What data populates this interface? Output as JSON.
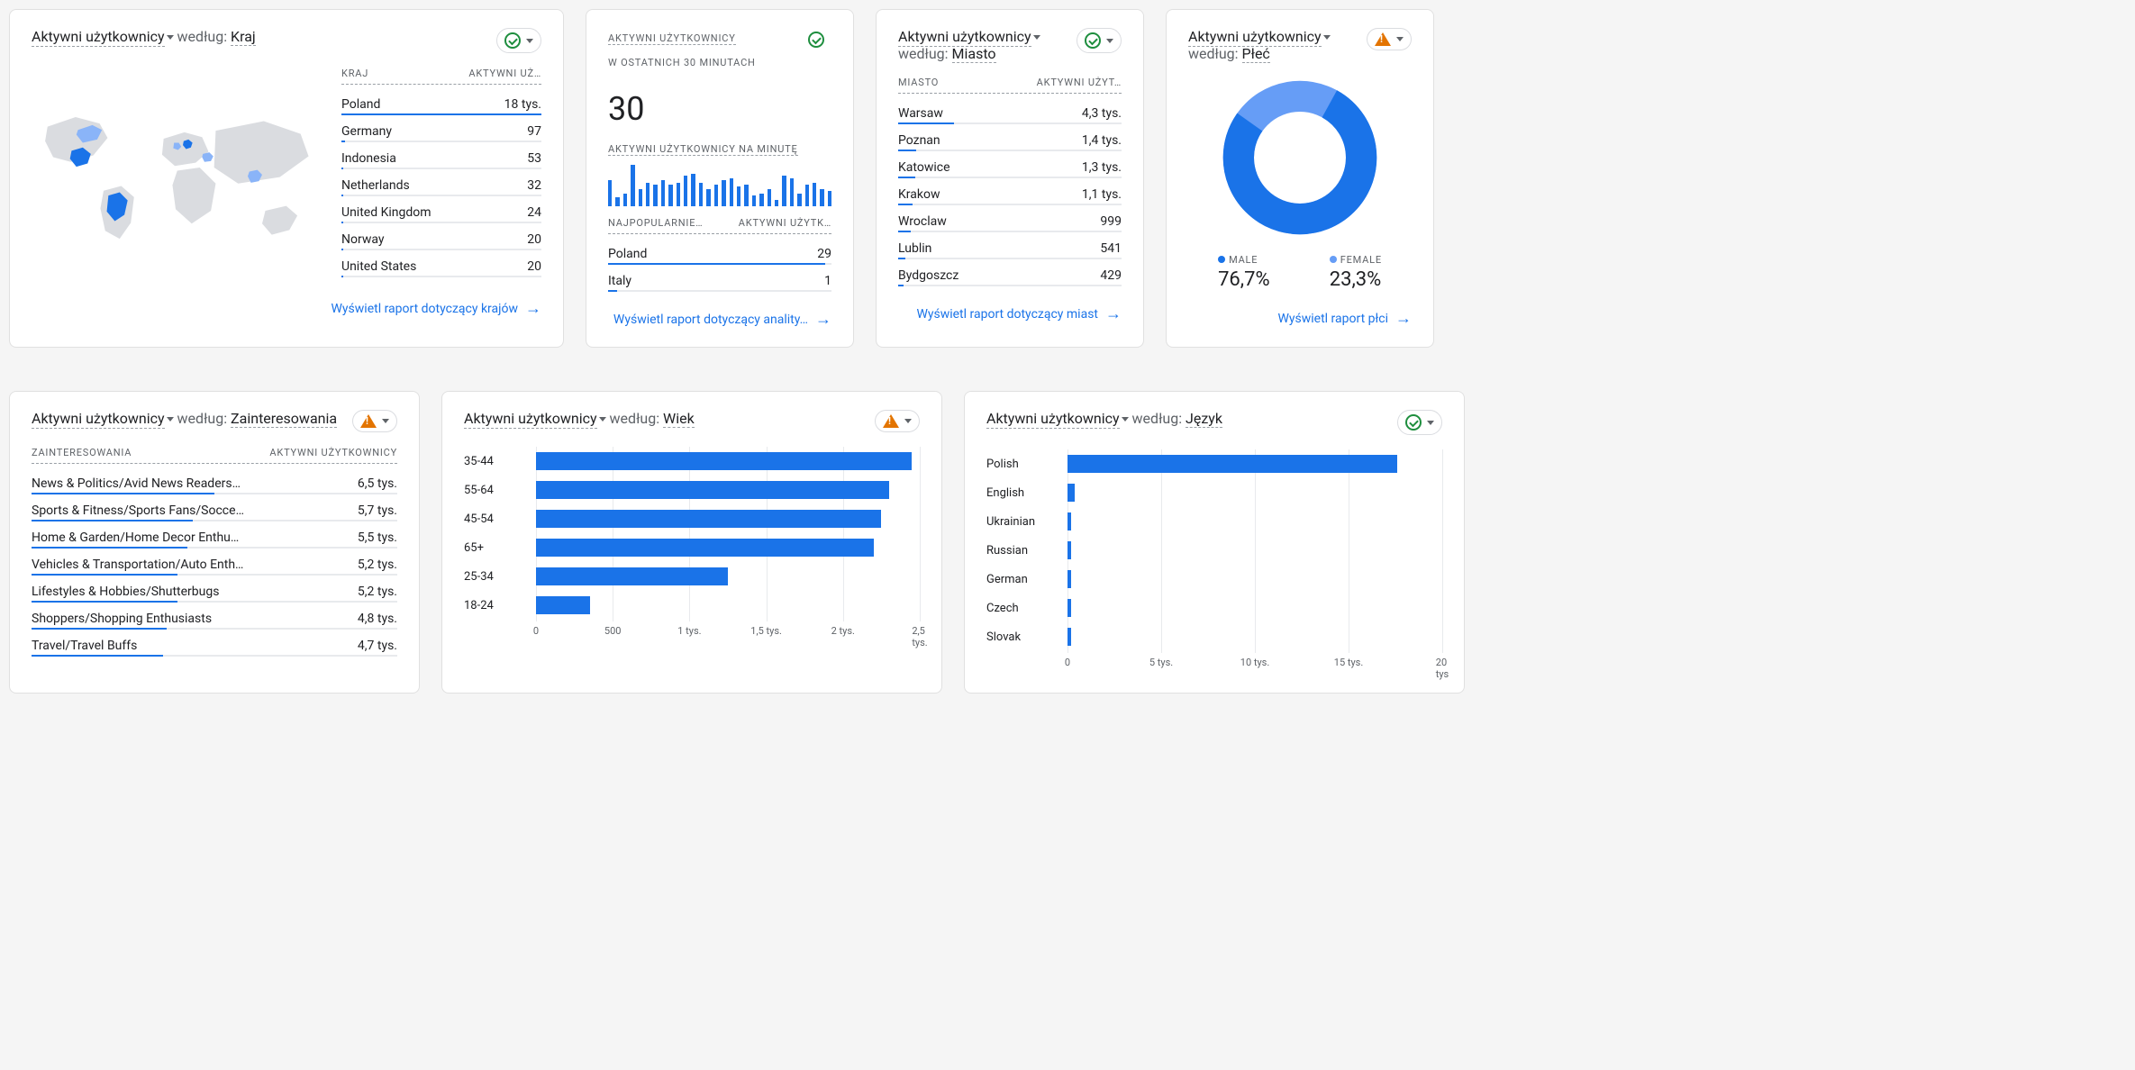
{
  "common": {
    "metric": "Aktywni użytkownicy",
    "by": "według:"
  },
  "card_country": {
    "dimension": "Kraj",
    "status": "ok",
    "header_dim": "KRAJ",
    "header_val": "AKTYWNI UŻ…",
    "rows": [
      {
        "label": "Poland",
        "value": "18 tys.",
        "pct": 100
      },
      {
        "label": "Germany",
        "value": "97",
        "pct": 2
      },
      {
        "label": "Indonesia",
        "value": "53",
        "pct": 1
      },
      {
        "label": "Netherlands",
        "value": "32",
        "pct": 1
      },
      {
        "label": "United Kingdom",
        "value": "24",
        "pct": 1
      },
      {
        "label": "Norway",
        "value": "20",
        "pct": 1
      },
      {
        "label": "United States",
        "value": "20",
        "pct": 1
      }
    ],
    "link": "Wyświetl raport dotyczący krajów"
  },
  "card_realtime": {
    "title1": "AKTYWNI UŻYTKOWNICY",
    "title2": "W OSTATNICH 30 MINUTACH",
    "big": "30",
    "per_min": "AKTYWNI UŻYTKOWNICY NA MINUTĘ",
    "spark": [
      60,
      20,
      30,
      95,
      40,
      55,
      50,
      60,
      50,
      55,
      70,
      75,
      55,
      40,
      50,
      60,
      65,
      45,
      50,
      25,
      30,
      40,
      15,
      70,
      65,
      30,
      50,
      55,
      40,
      35
    ],
    "header_dim": "NAJPOPULARNIE…",
    "header_val": "AKTYWNI UŻYTK…",
    "rows": [
      {
        "label": "Poland",
        "value": "29",
        "pct": 97
      },
      {
        "label": "Italy",
        "value": "1",
        "pct": 4
      }
    ],
    "link": "Wyświetl raport dotyczący anality…",
    "status": "ok"
  },
  "card_city": {
    "dimension": "Miasto",
    "status": "ok",
    "header_dim": "MIASTO",
    "header_val": "AKTYWNI UŻYT…",
    "rows": [
      {
        "label": "Warsaw",
        "value": "4,3 tys.",
        "pct": 100
      },
      {
        "label": "Poznan",
        "value": "1,4 tys.",
        "pct": 33
      },
      {
        "label": "Katowice",
        "value": "1,3 tys.",
        "pct": 30
      },
      {
        "label": "Krakow",
        "value": "1,1 tys.",
        "pct": 26
      },
      {
        "label": "Wroclaw",
        "value": "999",
        "pct": 23
      },
      {
        "label": "Lublin",
        "value": "541",
        "pct": 13
      },
      {
        "label": "Bydgoszcz",
        "value": "429",
        "pct": 10
      }
    ],
    "link": "Wyświetl raport dotyczący miast"
  },
  "card_gender": {
    "dimension": "Płeć",
    "status": "warn",
    "legend": [
      {
        "label": "MALE",
        "value": "76,7%",
        "color": "#1a73e8"
      },
      {
        "label": "FEMALE",
        "value": "23,3%",
        "color": "#669df6"
      }
    ],
    "link": "Wyświetl raport płci"
  },
  "card_interests": {
    "dimension": "Zainteresowania",
    "status": "warn",
    "header_dim": "ZAINTERESOWANIA",
    "header_val": "AKTYWNI UŻYTKOWNICY",
    "rows": [
      {
        "label": "News & Politics/Avid News Readers…",
        "value": "6,5 tys.",
        "pct": 100
      },
      {
        "label": "Sports & Fitness/Sports Fans/Socce…",
        "value": "5,7 tys.",
        "pct": 88
      },
      {
        "label": "Home & Garden/Home Decor Enthu…",
        "value": "5,5 tys.",
        "pct": 85
      },
      {
        "label": "Vehicles & Transportation/Auto Enth…",
        "value": "5,2 tys.",
        "pct": 80
      },
      {
        "label": "Lifestyles & Hobbies/Shutterbugs",
        "value": "5,2 tys.",
        "pct": 80
      },
      {
        "label": "Shoppers/Shopping Enthusiasts",
        "value": "4,8 tys.",
        "pct": 74
      },
      {
        "label": "Travel/Travel Buffs",
        "value": "4,7 tys.",
        "pct": 72
      }
    ]
  },
  "card_age": {
    "dimension": "Wiek",
    "status": "warn",
    "ticks": [
      "0",
      "500",
      "1 tys.",
      "1,5 tys.",
      "2 tys.",
      "2,5 tys."
    ],
    "bars": [
      {
        "label": "35-44",
        "value": 2450,
        "pct": 98
      },
      {
        "label": "55-64",
        "value": 2300,
        "pct": 92
      },
      {
        "label": "45-54",
        "value": 2250,
        "pct": 90
      },
      {
        "label": "65+",
        "value": 2200,
        "pct": 88
      },
      {
        "label": "25-34",
        "value": 1250,
        "pct": 50
      },
      {
        "label": "18-24",
        "value": 350,
        "pct": 14
      }
    ]
  },
  "card_language": {
    "dimension": "Język",
    "status": "ok",
    "ticks": [
      "0",
      "5 tys.",
      "10 tys.",
      "15 tys.",
      "20 tys"
    ],
    "bars": [
      {
        "label": "Polish",
        "value": 17500,
        "pct": 88
      },
      {
        "label": "English",
        "value": 350,
        "pct": 2
      },
      {
        "label": "Ukrainian",
        "value": 200,
        "pct": 1
      },
      {
        "label": "Russian",
        "value": 150,
        "pct": 1
      },
      {
        "label": "German",
        "value": 120,
        "pct": 1
      },
      {
        "label": "Czech",
        "value": 100,
        "pct": 1
      },
      {
        "label": "Slovak",
        "value": 80,
        "pct": 1
      }
    ]
  },
  "chart_data": [
    {
      "type": "table",
      "title": "Aktywni użytkownicy według Kraj",
      "categories": [
        "Poland",
        "Germany",
        "Indonesia",
        "Netherlands",
        "United Kingdom",
        "Norway",
        "United States"
      ],
      "values": [
        18000,
        97,
        53,
        32,
        24,
        20,
        20
      ]
    },
    {
      "type": "bar",
      "title": "Aktywni użytkownicy na minutę (ostatnie 30 min)",
      "x": [
        1,
        2,
        3,
        4,
        5,
        6,
        7,
        8,
        9,
        10,
        11,
        12,
        13,
        14,
        15,
        16,
        17,
        18,
        19,
        20,
        21,
        22,
        23,
        24,
        25,
        26,
        27,
        28,
        29,
        30
      ],
      "values": [
        60,
        20,
        30,
        95,
        40,
        55,
        50,
        60,
        50,
        55,
        70,
        75,
        55,
        40,
        50,
        60,
        65,
        45,
        50,
        25,
        30,
        40,
        15,
        70,
        65,
        30,
        50,
        55,
        40,
        35
      ],
      "total": 30
    },
    {
      "type": "table",
      "title": "Aktywni użytkownicy według Miasto",
      "categories": [
        "Warsaw",
        "Poznan",
        "Katowice",
        "Krakow",
        "Wroclaw",
        "Lublin",
        "Bydgoszcz"
      ],
      "values": [
        4300,
        1400,
        1300,
        1100,
        999,
        541,
        429
      ]
    },
    {
      "type": "pie",
      "title": "Aktywni użytkownicy według Płeć",
      "categories": [
        "MALE",
        "FEMALE"
      ],
      "values": [
        76.7,
        23.3
      ]
    },
    {
      "type": "table",
      "title": "Aktywni użytkownicy według Zainteresowania",
      "categories": [
        "News & Politics/Avid News Readers",
        "Sports & Fitness/Sports Fans/Soccer",
        "Home & Garden/Home Decor Enthusiasts",
        "Vehicles & Transportation/Auto Enthusiasts",
        "Lifestyles & Hobbies/Shutterbugs",
        "Shoppers/Shopping Enthusiasts",
        "Travel/Travel Buffs"
      ],
      "values": [
        6500,
        5700,
        5500,
        5200,
        5200,
        4800,
        4700
      ]
    },
    {
      "type": "bar",
      "title": "Aktywni użytkownicy według Wiek",
      "categories": [
        "35-44",
        "55-64",
        "45-54",
        "65+",
        "25-34",
        "18-24"
      ],
      "values": [
        2450,
        2300,
        2250,
        2200,
        1250,
        350
      ],
      "xlabel": "",
      "ylabel": "",
      "xlim": [
        0,
        2500
      ]
    },
    {
      "type": "bar",
      "title": "Aktywni użytkownicy według Język",
      "categories": [
        "Polish",
        "English",
        "Ukrainian",
        "Russian",
        "German",
        "Czech",
        "Slovak"
      ],
      "values": [
        17500,
        350,
        200,
        150,
        120,
        100,
        80
      ],
      "xlabel": "",
      "ylabel": "",
      "xlim": [
        0,
        20000
      ]
    }
  ]
}
